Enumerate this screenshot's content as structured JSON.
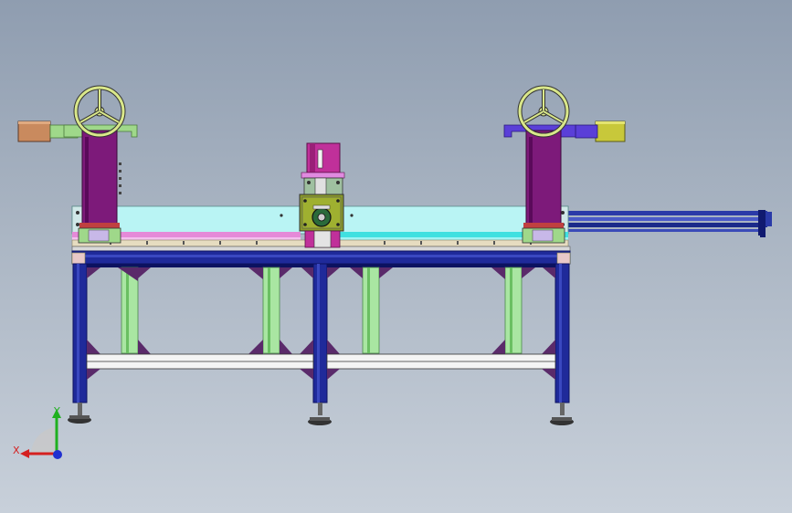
{
  "viewport": {
    "background_top": "#8f9db0",
    "background_bottom": "#c8d0da"
  },
  "colors": {
    "frame_blue": "#1f2a9a",
    "frame_dark": "#0c1260",
    "leg_green": "#a9e6a2",
    "column_purple": "#7d1a7a",
    "handwheel_yellow": "#d9e78a",
    "arm_green": "#9fd88a",
    "arm_blue": "#5a3fd8",
    "motor_brown": "#c98a5e",
    "motor_olive": "#c8c83a",
    "table_cyan": "#b9f4f4",
    "rail_magenta": "#e58ad8",
    "rail_cyan": "#3fe0e0",
    "center_head_magenta": "#c0309a",
    "center_head_olive": "#8a9a2a",
    "rod_blue": "#2a3aa8"
  },
  "triad": {
    "x_label": "X",
    "y_label": "Y",
    "x_color": "#d42020",
    "y_color": "#20b020",
    "z_color": "#2030d0"
  }
}
